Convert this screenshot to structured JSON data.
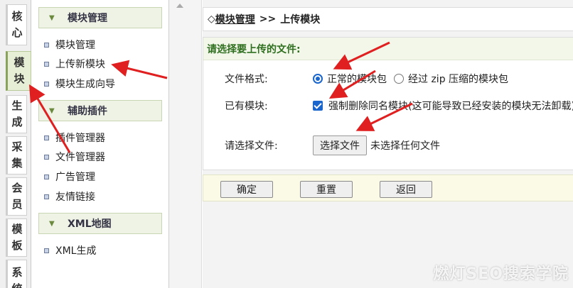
{
  "tabs": [
    {
      "label": "核心",
      "active": false
    },
    {
      "label": "模块",
      "active": true
    },
    {
      "label": "生成",
      "active": false
    },
    {
      "label": "采集",
      "active": false
    },
    {
      "label": "会员",
      "active": false
    },
    {
      "label": "模板",
      "active": false
    },
    {
      "label": "系统",
      "active": false
    }
  ],
  "menu": {
    "groups": [
      {
        "title": "模块管理",
        "items": [
          "模块管理",
          "上传新模块",
          "模块生成向导"
        ]
      },
      {
        "title": "辅助插件",
        "items": [
          "插件管理器",
          "文件管理器",
          "广告管理",
          "友情链接"
        ]
      },
      {
        "title": "XML地图",
        "items": [
          "XML生成"
        ]
      }
    ]
  },
  "breadcrumb": {
    "prefix": "◇",
    "link": "模块管理",
    "separator": ">>",
    "current": "上传模块"
  },
  "form": {
    "title": "请选择要上传的文件:",
    "format_label": "文件格式:",
    "format_options": [
      "正常的模块包",
      "经过 zip 压缩的模块包"
    ],
    "format_selected": 0,
    "existing_label": "已有模块:",
    "existing_checkbox_text": "强制删除同名模块(这可能导致已经安装的模块无法卸载)",
    "file_label": "请选择文件:",
    "file_button": "选择文件",
    "file_status": "未选择任何文件"
  },
  "actions": {
    "confirm": "确定",
    "reset": "重置",
    "back": "返回"
  },
  "watermark": "燃灯SEO搜索学院",
  "colors": {
    "accent": "#1a66cc",
    "panel_title": "#2f6f1f",
    "arrow": "#e02020"
  }
}
